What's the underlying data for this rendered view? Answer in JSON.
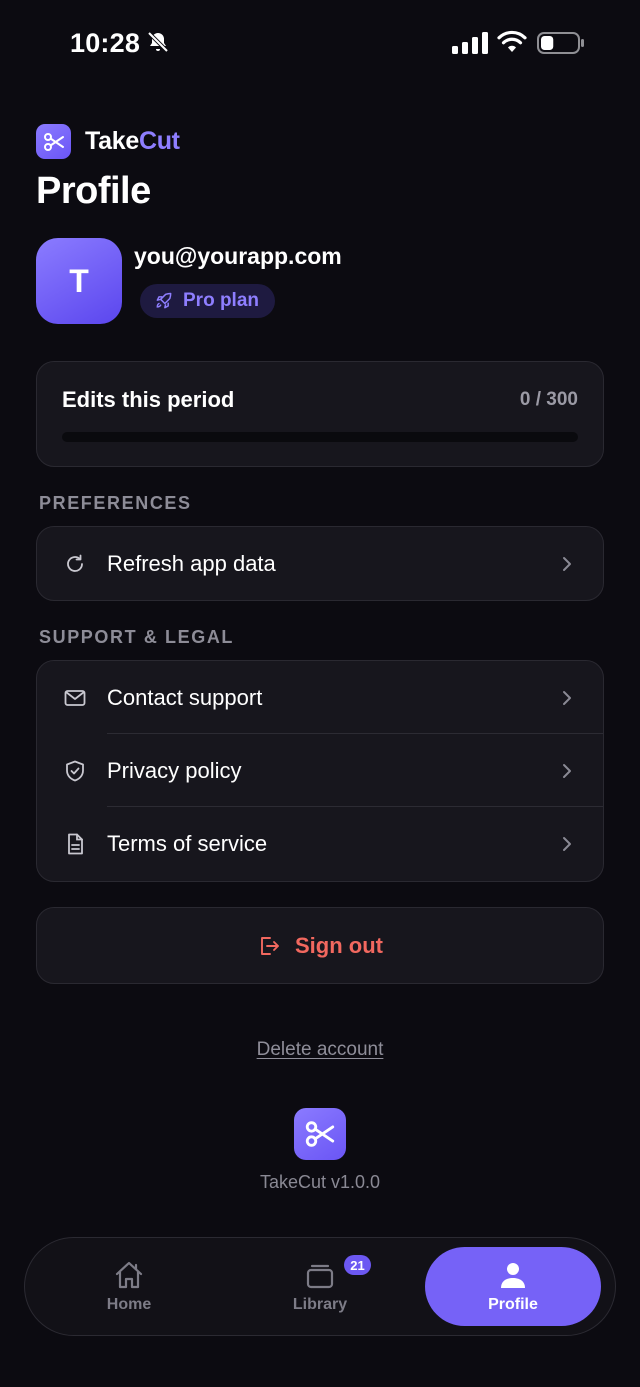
{
  "status_bar": {
    "time": "10:28",
    "battery_level": 0.35
  },
  "brand": {
    "name_part1": "Take",
    "name_part2": "Cut"
  },
  "page": {
    "title": "Profile"
  },
  "user": {
    "avatar_initial": "T",
    "email": "you@yourapp.com",
    "plan": "Pro plan"
  },
  "usage": {
    "label": "Edits this period",
    "count": "0 / 300",
    "used": 0,
    "limit": 300
  },
  "preferences": {
    "header": "PREFERENCES",
    "items": [
      {
        "label": "Refresh app data",
        "icon": "refresh-icon"
      }
    ]
  },
  "support": {
    "header": "SUPPORT & LEGAL",
    "items": [
      {
        "label": "Contact support",
        "icon": "mail-icon"
      },
      {
        "label": "Privacy policy",
        "icon": "shield-icon"
      },
      {
        "label": "Terms of service",
        "icon": "document-icon"
      }
    ]
  },
  "actions": {
    "sign_out": "Sign out",
    "delete_account": "Delete account"
  },
  "footer": {
    "version": "TakeCut v1.0.0"
  },
  "tabbar": {
    "home": "Home",
    "library": "Library",
    "library_badge": "21",
    "profile": "Profile",
    "active": "profile"
  },
  "colors": {
    "accent": "#7662f7",
    "danger": "#f2685f",
    "background": "#0c0b11"
  }
}
